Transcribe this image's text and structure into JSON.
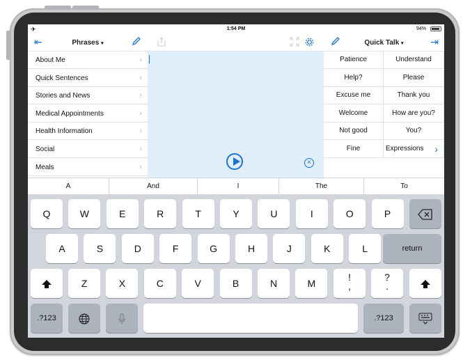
{
  "status": {
    "time": "1:54 PM",
    "battery": "94%"
  },
  "left_panel": {
    "title": "Phrases",
    "items": [
      {
        "label": "About Me"
      },
      {
        "label": "Quick Sentences"
      },
      {
        "label": "Stories and News"
      },
      {
        "label": "Medical Appointments"
      },
      {
        "label": "Health Information"
      },
      {
        "label": "Social"
      },
      {
        "label": "Meals"
      }
    ]
  },
  "right_panel": {
    "title": "Quick Talk",
    "cells": [
      [
        "Patience",
        "Understand"
      ],
      [
        "Help?",
        "Please"
      ],
      [
        "Excuse me",
        "Thank you"
      ],
      [
        "Welcome",
        "How are you?"
      ],
      [
        "Not good",
        "You?"
      ],
      [
        "Fine",
        "Expressions"
      ]
    ]
  },
  "predictions": [
    "A",
    "And",
    "I",
    "The",
    "To"
  ],
  "keyboard": {
    "row1": [
      "Q",
      "W",
      "E",
      "R",
      "T",
      "Y",
      "U",
      "I",
      "O",
      "P"
    ],
    "row2": [
      "A",
      "S",
      "D",
      "F",
      "G",
      "H",
      "J",
      "K",
      "L"
    ],
    "return_label": "return",
    "row3": [
      "Z",
      "X",
      "C",
      "V",
      "B",
      "N",
      "M"
    ],
    "exclaim_key": [
      "!",
      ","
    ],
    "question_key": [
      "?",
      "."
    ],
    "numbers_label": ".?123"
  },
  "colors": {
    "accent": "#1a73d9",
    "editor_bg": "#e0eefa",
    "keyboard_bg": "#d2d5db"
  }
}
